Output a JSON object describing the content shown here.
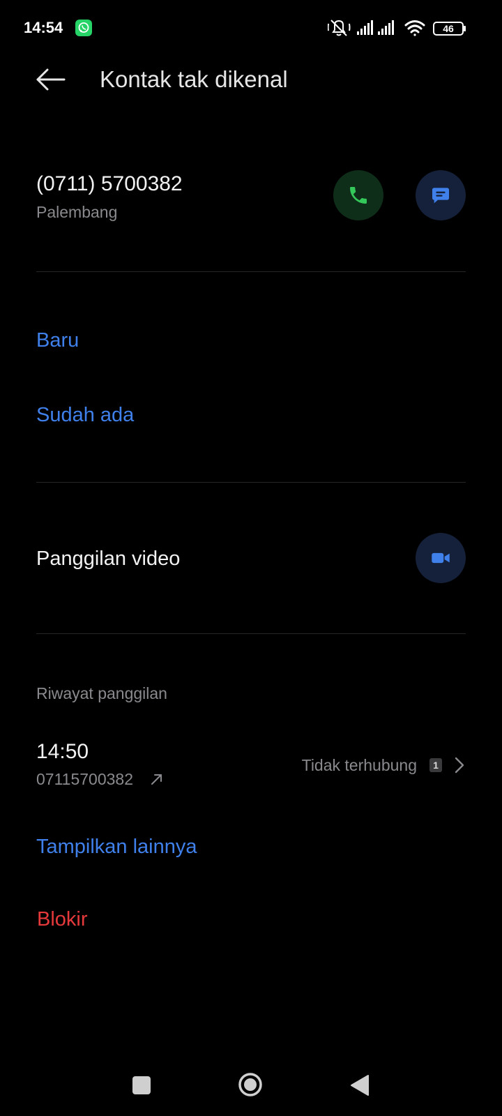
{
  "status_bar": {
    "time": "14:54",
    "battery": "46",
    "icons": [
      "whatsapp-icon",
      "mute-icon",
      "signal-icon",
      "signal-icon",
      "wifi-icon",
      "battery-icon"
    ]
  },
  "header": {
    "title": "Kontak tak dikenal",
    "back_icon": "arrow-left-icon"
  },
  "contact": {
    "number": "(0711) 5700382",
    "location": "Palembang",
    "call_icon": "phone-icon",
    "message_icon": "message-icon"
  },
  "add_contact": {
    "new_label": "Baru",
    "existing_label": "Sudah ada"
  },
  "video": {
    "label": "Panggilan video",
    "icon": "video-camera-icon"
  },
  "history": {
    "section_label": "Riwayat panggilan",
    "entries": [
      {
        "time": "14:50",
        "number": "07115700382",
        "direction_icon": "outgoing-arrow-icon",
        "status": "Tidak terhubung",
        "count": "1"
      }
    ],
    "show_more_label": "Tampilkan lainnya"
  },
  "block": {
    "label": "Blokir"
  },
  "nav_bar": {
    "icons": [
      "recents-square-icon",
      "home-circle-icon",
      "back-triangle-icon"
    ]
  },
  "colors": {
    "background": "#000000",
    "accent_blue": "#3f80ea",
    "danger_red": "#e5393b",
    "call_green": "#34c759",
    "secondary_text": "#8a8a8e"
  }
}
